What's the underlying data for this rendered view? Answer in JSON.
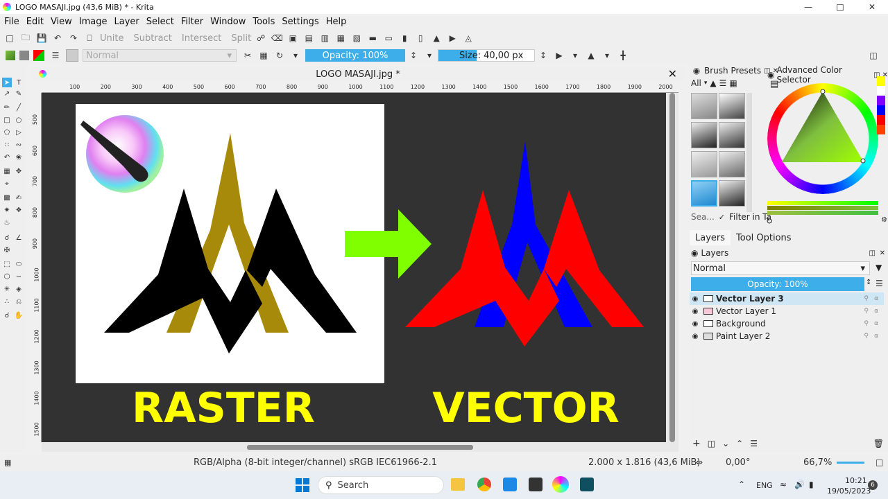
{
  "window": {
    "title": "LOGO MASAJI.jpg (43,6 MiB)  * - Krita",
    "min_icon": "minimize-icon",
    "max_icon": "maximize-icon",
    "close_icon": "close-icon"
  },
  "menubar": [
    "File",
    "Edit",
    "View",
    "Image",
    "Layer",
    "Select",
    "Filter",
    "Window",
    "Tools",
    "Settings",
    "Help"
  ],
  "toolbar1": {
    "unite": "Unite",
    "subtract": "Subtract",
    "intersect": "Intersect",
    "split": "Split"
  },
  "toolbar2": {
    "blend_mode": "Normal",
    "opacity": "Opacity: 100%",
    "size_label": "Size:",
    "size_value": "40,00 px"
  },
  "document": {
    "tab_title": "LOGO MASAJI.jpg *"
  },
  "ruler_h": [
    "100",
    "200",
    "300",
    "400",
    "500",
    "600",
    "700",
    "800",
    "900",
    "1000",
    "1100",
    "1200",
    "1300",
    "1400",
    "1500",
    "1600",
    "1700",
    "1800",
    "1900",
    "2000"
  ],
  "ruler_v": [
    "500",
    "600",
    "700",
    "800",
    "900",
    "1000",
    "1100",
    "1200",
    "1300",
    "1400",
    "1500"
  ],
  "artwork": {
    "left_label": "RASTER",
    "right_label": "VECTOR",
    "colors": {
      "canvas_bg": "#323232",
      "raster_black": "#000000",
      "raster_gold": "#a88a0a",
      "vector_red": "#ff0000",
      "vector_blue": "#0000ff",
      "arrow_green": "#7fff00",
      "label_yellow": "#ffff00"
    }
  },
  "brush_presets": {
    "header": "Brush Presets",
    "filter_all": "All",
    "search_placeholder": "Sea...",
    "filter_label": "Filter in Ta"
  },
  "color_selector": {
    "header": "Advanced Color Selector"
  },
  "layers_panel": {
    "tab_layers": "Layers",
    "tab_tool_options": "Tool Options",
    "header": "Layers",
    "blend_mode": "Normal",
    "opacity": "Opacity:  100%",
    "layers": [
      {
        "name": "Vector Layer 3",
        "selected": true
      },
      {
        "name": "Vector Layer 1",
        "selected": false
      },
      {
        "name": "Background",
        "selected": false
      },
      {
        "name": "Paint Layer 2",
        "selected": false
      }
    ]
  },
  "statusbar": {
    "color_space": "RGB/Alpha (8-bit integer/channel)  sRGB IEC61966-2.1",
    "dimensions": "2.000 x 1.816 (43,6 MiB)",
    "rotation": "0,00°",
    "zoom": "66,7%"
  },
  "taskbar": {
    "search_placeholder": "Search",
    "language": "ENG",
    "time": "10:21",
    "date": "19/05/2023",
    "notification_count": "6"
  }
}
